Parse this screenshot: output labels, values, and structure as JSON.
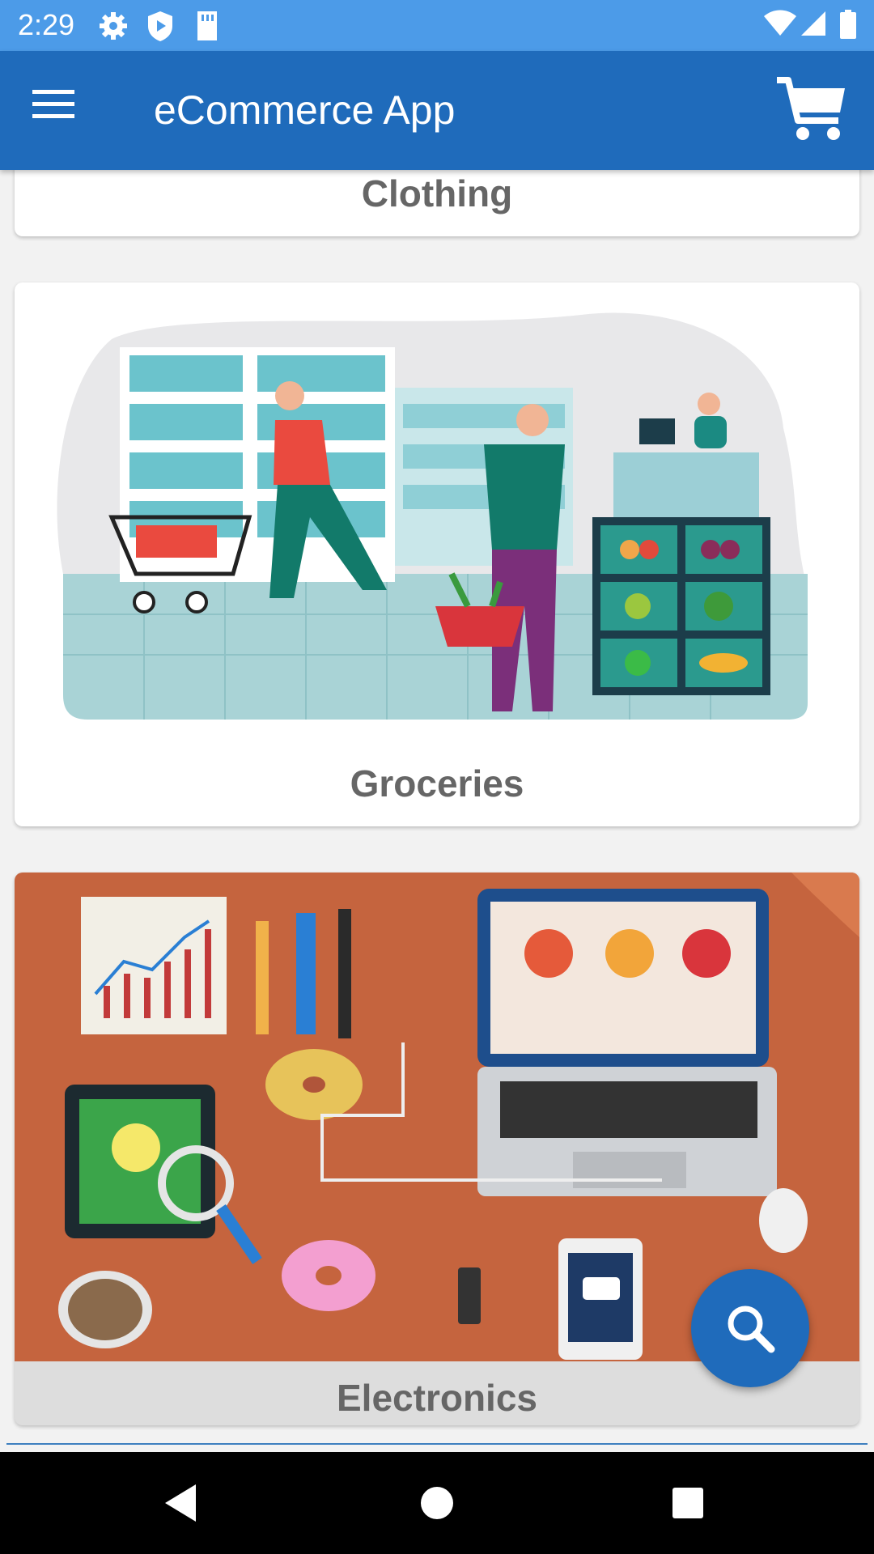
{
  "status_bar": {
    "time": "2:29",
    "icons": [
      "gear-icon",
      "shield-play-icon",
      "sd-card-icon",
      "wifi-icon",
      "signal-icon",
      "battery-icon"
    ]
  },
  "app_bar": {
    "title": "eCommerce App",
    "menu_icon": "hamburger-menu-icon",
    "cart_icon": "shopping-cart-icon"
  },
  "categories": [
    {
      "label": "Clothing"
    },
    {
      "label": "Groceries",
      "image": "supermarket-shopping-illustration"
    },
    {
      "label": "Electronics",
      "image": "desk-with-laptop-and-gadgets-illustration"
    }
  ],
  "fab": {
    "icon": "search-icon"
  },
  "nav_bar": {
    "icons": [
      "back-icon",
      "home-icon",
      "recents-icon"
    ]
  },
  "colors": {
    "status_bar": "#4c9be8",
    "app_bar": "#1f6bbb",
    "fab": "#1f6bbb",
    "label_text": "#666666",
    "electronics_bg": "#c5643e"
  }
}
